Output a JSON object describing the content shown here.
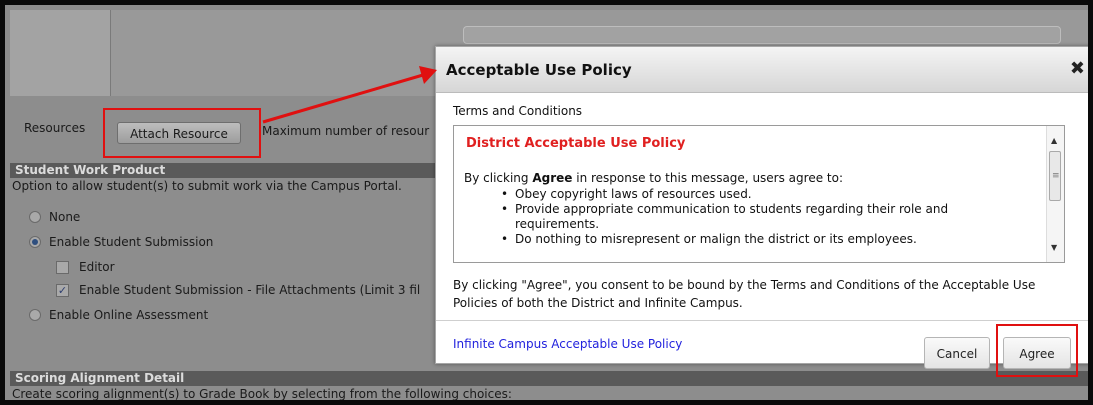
{
  "background": {
    "resources_label": "Resources",
    "attach_resource_label": "Attach Resource",
    "max_resources_text": "Maximum number of resour",
    "student_work_header": "Student Work Product",
    "student_work_desc": "Option to allow student(s) to submit work via the Campus Portal.",
    "options": {
      "none": "None",
      "enable_student_submission": "Enable Student Submission",
      "editor": "Editor",
      "file_attachments": "Enable Student Submission - File Attachments (Limit 3 fil",
      "online_assessment": "Enable Online Assessment"
    },
    "scoring_header": "Scoring Alignment Detail",
    "scoring_desc": "Create scoring alignment(s) to Grade Book by selecting from the following choices:"
  },
  "modal": {
    "title": "Acceptable Use Policy",
    "close_label": "✖",
    "terms_title": "Terms and Conditions",
    "policy_heading": "District Acceptable Use Policy",
    "intro_prefix": "By clicking ",
    "intro_bold": "Agree",
    "intro_suffix": " in response to this message, users agree to:",
    "items": [
      "Obey copyright laws of resources used.",
      "Provide appropriate communication to students regarding their role and requirements.",
      "Do nothing to misrepresent or malign the district or its employees."
    ],
    "consent_text": "By clicking \"Agree\", you consent to be bound by the Terms and Conditions of the Acceptable Use Policies of both the District and Infinite Campus.",
    "link_label": "Infinite Campus Acceptable Use Policy",
    "cancel_label": "Cancel",
    "agree_label": "Agree"
  },
  "colors": {
    "annotation_red": "#e01010",
    "policy_heading_red": "#e02020",
    "link_blue": "#2222dd",
    "section_header_bg": "#5a5a5a",
    "overlay_gray": "#8d8d8d"
  }
}
